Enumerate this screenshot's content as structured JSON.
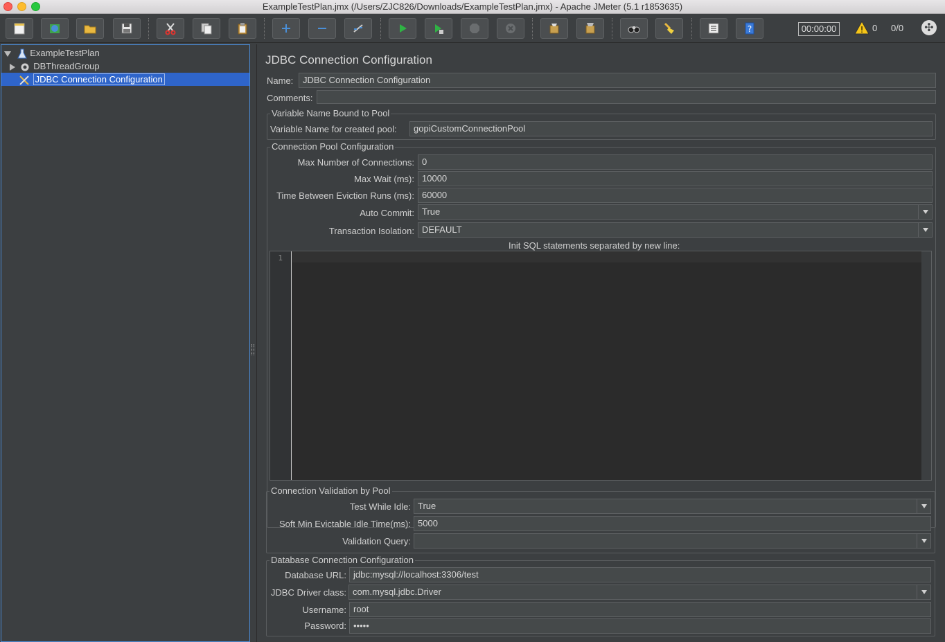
{
  "window": {
    "title": "ExampleTestPlan.jmx (/Users/ZJC826/Downloads/ExampleTestPlan.jmx) - Apache JMeter (5.1 r1853635)"
  },
  "toolbar": {
    "buttons": [
      {
        "name": "new",
        "icon": "new-file-icon"
      },
      {
        "name": "templates",
        "icon": "templates-icon"
      },
      {
        "name": "open",
        "icon": "open-folder-icon"
      },
      {
        "name": "save",
        "icon": "save-icon"
      },
      {
        "name": "cut",
        "icon": "cut-icon"
      },
      {
        "name": "copy",
        "icon": "copy-icon"
      },
      {
        "name": "paste",
        "icon": "paste-icon"
      },
      {
        "name": "expand",
        "icon": "plus-icon"
      },
      {
        "name": "collapse",
        "icon": "minus-icon"
      },
      {
        "name": "toggle",
        "icon": "toggle-icon"
      },
      {
        "name": "start",
        "icon": "play-icon"
      },
      {
        "name": "start-no-pauses",
        "icon": "play-no-pause-icon"
      },
      {
        "name": "stop",
        "icon": "stop-icon"
      },
      {
        "name": "shutdown",
        "icon": "shutdown-icon"
      },
      {
        "name": "clear",
        "icon": "clear-icon"
      },
      {
        "name": "clear-all",
        "icon": "clear-all-icon"
      },
      {
        "name": "search",
        "icon": "binoculars-icon"
      },
      {
        "name": "reset-search",
        "icon": "broom-icon"
      },
      {
        "name": "function-helper",
        "icon": "list-icon"
      },
      {
        "name": "help",
        "icon": "help-icon"
      }
    ],
    "timer": "00:00:00",
    "warnings": "0",
    "threads": "0/0"
  },
  "tree": {
    "items": [
      {
        "label": "ExampleTestPlan",
        "icon": "test-plan-icon",
        "expanded": true
      },
      {
        "label": "DBThreadGroup",
        "icon": "gear-icon",
        "expanded": false
      },
      {
        "label": "JDBC Connection Configuration",
        "icon": "tools-icon",
        "selected": true
      }
    ]
  },
  "form": {
    "heading": "JDBC Connection Configuration",
    "name_label": "Name:",
    "name_value": "JDBC Connection Configuration",
    "comments_label": "Comments:",
    "comments_value": "",
    "pool_var_group": "Variable Name Bound to Pool",
    "pool_var_label": "Variable Name for created pool:",
    "pool_var_value": "gopiCustomConnectionPool",
    "pool_cfg_group": "Connection Pool Configuration",
    "max_conn_label": "Max Number of Connections:",
    "max_conn_value": "0",
    "max_wait_label": "Max Wait (ms):",
    "max_wait_value": "10000",
    "eviction_label": "Time Between Eviction Runs (ms):",
    "eviction_value": "60000",
    "auto_commit_label": "Auto Commit:",
    "auto_commit_value": "True",
    "isolation_label": "Transaction Isolation:",
    "isolation_value": "DEFAULT",
    "init_sql_label": "Init SQL statements separated by new line:",
    "init_sql_line": "1",
    "validation_group": "Connection Validation by Pool",
    "test_idle_label": "Test While Idle:",
    "test_idle_value": "True",
    "soft_min_label": "Soft Min Evictable Idle Time(ms):",
    "soft_min_value": "5000",
    "validation_query_label": "Validation Query:",
    "validation_query_value": "",
    "db_group": "Database Connection Configuration",
    "db_url_label": "Database URL:",
    "db_url_value": "jdbc:mysql://localhost:3306/test",
    "driver_label": "JDBC Driver class:",
    "driver_value": "com.mysql.jdbc.Driver",
    "username_label": "Username:",
    "username_value": "root",
    "password_label": "Password:",
    "password_value": "•••••"
  }
}
